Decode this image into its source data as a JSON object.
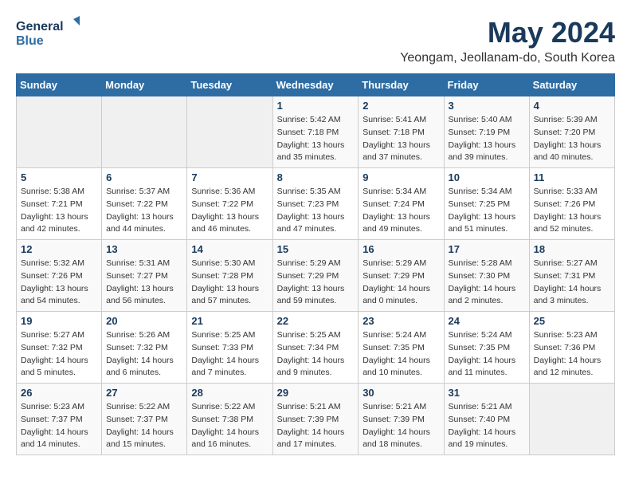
{
  "header": {
    "logo_general": "General",
    "logo_blue": "Blue",
    "title": "May 2024",
    "subtitle": "Yeongam, Jeollanam-do, South Korea"
  },
  "weekdays": [
    "Sunday",
    "Monday",
    "Tuesday",
    "Wednesday",
    "Thursday",
    "Friday",
    "Saturday"
  ],
  "weeks": [
    [
      {
        "day": "",
        "sunrise": "",
        "sunset": "",
        "daylight": ""
      },
      {
        "day": "",
        "sunrise": "",
        "sunset": "",
        "daylight": ""
      },
      {
        "day": "",
        "sunrise": "",
        "sunset": "",
        "daylight": ""
      },
      {
        "day": "1",
        "sunrise": "Sunrise: 5:42 AM",
        "sunset": "Sunset: 7:18 PM",
        "daylight": "Daylight: 13 hours and 35 minutes."
      },
      {
        "day": "2",
        "sunrise": "Sunrise: 5:41 AM",
        "sunset": "Sunset: 7:18 PM",
        "daylight": "Daylight: 13 hours and 37 minutes."
      },
      {
        "day": "3",
        "sunrise": "Sunrise: 5:40 AM",
        "sunset": "Sunset: 7:19 PM",
        "daylight": "Daylight: 13 hours and 39 minutes."
      },
      {
        "day": "4",
        "sunrise": "Sunrise: 5:39 AM",
        "sunset": "Sunset: 7:20 PM",
        "daylight": "Daylight: 13 hours and 40 minutes."
      }
    ],
    [
      {
        "day": "5",
        "sunrise": "Sunrise: 5:38 AM",
        "sunset": "Sunset: 7:21 PM",
        "daylight": "Daylight: 13 hours and 42 minutes."
      },
      {
        "day": "6",
        "sunrise": "Sunrise: 5:37 AM",
        "sunset": "Sunset: 7:22 PM",
        "daylight": "Daylight: 13 hours and 44 minutes."
      },
      {
        "day": "7",
        "sunrise": "Sunrise: 5:36 AM",
        "sunset": "Sunset: 7:22 PM",
        "daylight": "Daylight: 13 hours and 46 minutes."
      },
      {
        "day": "8",
        "sunrise": "Sunrise: 5:35 AM",
        "sunset": "Sunset: 7:23 PM",
        "daylight": "Daylight: 13 hours and 47 minutes."
      },
      {
        "day": "9",
        "sunrise": "Sunrise: 5:34 AM",
        "sunset": "Sunset: 7:24 PM",
        "daylight": "Daylight: 13 hours and 49 minutes."
      },
      {
        "day": "10",
        "sunrise": "Sunrise: 5:34 AM",
        "sunset": "Sunset: 7:25 PM",
        "daylight": "Daylight: 13 hours and 51 minutes."
      },
      {
        "day": "11",
        "sunrise": "Sunrise: 5:33 AM",
        "sunset": "Sunset: 7:26 PM",
        "daylight": "Daylight: 13 hours and 52 minutes."
      }
    ],
    [
      {
        "day": "12",
        "sunrise": "Sunrise: 5:32 AM",
        "sunset": "Sunset: 7:26 PM",
        "daylight": "Daylight: 13 hours and 54 minutes."
      },
      {
        "day": "13",
        "sunrise": "Sunrise: 5:31 AM",
        "sunset": "Sunset: 7:27 PM",
        "daylight": "Daylight: 13 hours and 56 minutes."
      },
      {
        "day": "14",
        "sunrise": "Sunrise: 5:30 AM",
        "sunset": "Sunset: 7:28 PM",
        "daylight": "Daylight: 13 hours and 57 minutes."
      },
      {
        "day": "15",
        "sunrise": "Sunrise: 5:29 AM",
        "sunset": "Sunset: 7:29 PM",
        "daylight": "Daylight: 13 hours and 59 minutes."
      },
      {
        "day": "16",
        "sunrise": "Sunrise: 5:29 AM",
        "sunset": "Sunset: 7:29 PM",
        "daylight": "Daylight: 14 hours and 0 minutes."
      },
      {
        "day": "17",
        "sunrise": "Sunrise: 5:28 AM",
        "sunset": "Sunset: 7:30 PM",
        "daylight": "Daylight: 14 hours and 2 minutes."
      },
      {
        "day": "18",
        "sunrise": "Sunrise: 5:27 AM",
        "sunset": "Sunset: 7:31 PM",
        "daylight": "Daylight: 14 hours and 3 minutes."
      }
    ],
    [
      {
        "day": "19",
        "sunrise": "Sunrise: 5:27 AM",
        "sunset": "Sunset: 7:32 PM",
        "daylight": "Daylight: 14 hours and 5 minutes."
      },
      {
        "day": "20",
        "sunrise": "Sunrise: 5:26 AM",
        "sunset": "Sunset: 7:32 PM",
        "daylight": "Daylight: 14 hours and 6 minutes."
      },
      {
        "day": "21",
        "sunrise": "Sunrise: 5:25 AM",
        "sunset": "Sunset: 7:33 PM",
        "daylight": "Daylight: 14 hours and 7 minutes."
      },
      {
        "day": "22",
        "sunrise": "Sunrise: 5:25 AM",
        "sunset": "Sunset: 7:34 PM",
        "daylight": "Daylight: 14 hours and 9 minutes."
      },
      {
        "day": "23",
        "sunrise": "Sunrise: 5:24 AM",
        "sunset": "Sunset: 7:35 PM",
        "daylight": "Daylight: 14 hours and 10 minutes."
      },
      {
        "day": "24",
        "sunrise": "Sunrise: 5:24 AM",
        "sunset": "Sunset: 7:35 PM",
        "daylight": "Daylight: 14 hours and 11 minutes."
      },
      {
        "day": "25",
        "sunrise": "Sunrise: 5:23 AM",
        "sunset": "Sunset: 7:36 PM",
        "daylight": "Daylight: 14 hours and 12 minutes."
      }
    ],
    [
      {
        "day": "26",
        "sunrise": "Sunrise: 5:23 AM",
        "sunset": "Sunset: 7:37 PM",
        "daylight": "Daylight: 14 hours and 14 minutes."
      },
      {
        "day": "27",
        "sunrise": "Sunrise: 5:22 AM",
        "sunset": "Sunset: 7:37 PM",
        "daylight": "Daylight: 14 hours and 15 minutes."
      },
      {
        "day": "28",
        "sunrise": "Sunrise: 5:22 AM",
        "sunset": "Sunset: 7:38 PM",
        "daylight": "Daylight: 14 hours and 16 minutes."
      },
      {
        "day": "29",
        "sunrise": "Sunrise: 5:21 AM",
        "sunset": "Sunset: 7:39 PM",
        "daylight": "Daylight: 14 hours and 17 minutes."
      },
      {
        "day": "30",
        "sunrise": "Sunrise: 5:21 AM",
        "sunset": "Sunset: 7:39 PM",
        "daylight": "Daylight: 14 hours and 18 minutes."
      },
      {
        "day": "31",
        "sunrise": "Sunrise: 5:21 AM",
        "sunset": "Sunset: 7:40 PM",
        "daylight": "Daylight: 14 hours and 19 minutes."
      },
      {
        "day": "",
        "sunrise": "",
        "sunset": "",
        "daylight": ""
      }
    ]
  ],
  "colors": {
    "header_bg": "#2e6da4",
    "header_text": "#ffffff",
    "title_color": "#1a3a5c",
    "logo_blue": "#2e6da4"
  }
}
